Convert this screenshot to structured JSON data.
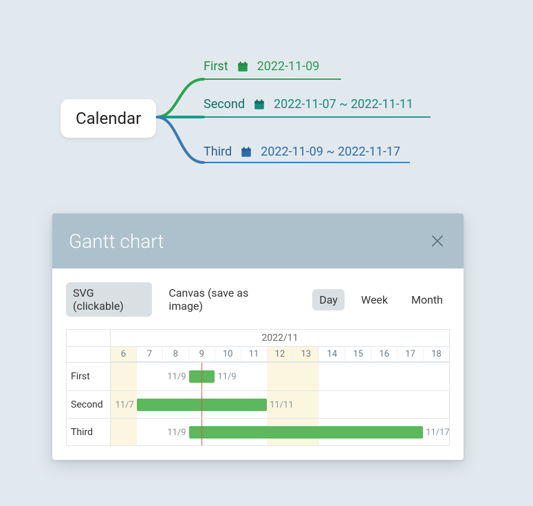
{
  "mindmap": {
    "root": "Calendar",
    "branches": [
      {
        "label": "First",
        "date": "2022-11-09",
        "color": "#259b50"
      },
      {
        "label": "Second",
        "date": "2022-11-07 ~ 2022-11-11",
        "color": "#138b7f"
      },
      {
        "label": "Third",
        "date": "2022-11-09 ~ 2022-11-17",
        "color": "#2e6ca8"
      }
    ]
  },
  "panel": {
    "title": "Gantt chart",
    "render_tabs": {
      "svg": "SVG (clickable)",
      "canvas": "Canvas (save as image)"
    },
    "zoom_tabs": {
      "day": "Day",
      "week": "Week",
      "month": "Month"
    },
    "render_active": "svg",
    "zoom_active": "day"
  },
  "chart_data": {
    "type": "gantt",
    "month_label": "2022/11",
    "days": [
      6,
      7,
      8,
      9,
      10,
      11,
      12,
      13,
      14,
      15,
      16,
      17,
      18
    ],
    "weekend_days": [
      6,
      12,
      13
    ],
    "today": 9.5,
    "rows": [
      {
        "name": "First",
        "start": 9,
        "end": 9,
        "start_label": "11/9",
        "end_label": "11/9"
      },
      {
        "name": "Second",
        "start": 7,
        "end": 11,
        "start_label": "11/7",
        "end_label": "11/11"
      },
      {
        "name": "Third",
        "start": 9,
        "end": 17,
        "start_label": "11/9",
        "end_label": "11/17"
      }
    ]
  }
}
